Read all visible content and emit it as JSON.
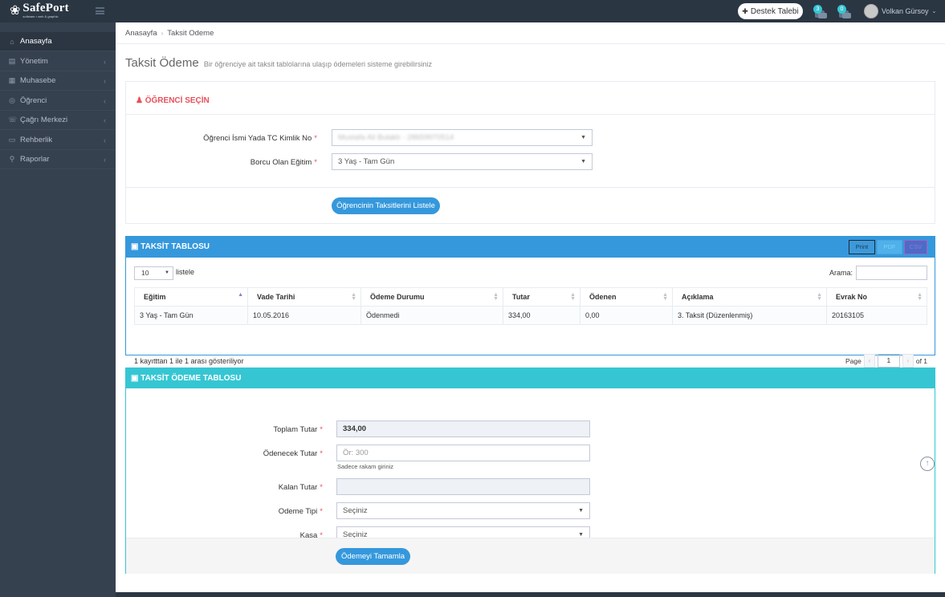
{
  "topbar": {
    "logo_name": "SafePort",
    "logo_tagline": "software • web & graphic",
    "support_label": "Destek Talebi",
    "notif_badge_1": "3",
    "notif_badge_2": "0",
    "user_name": "Volkan Gürsoy"
  },
  "sidebar": {
    "items": [
      {
        "label": "Anasayfa",
        "icon": "home-icon"
      },
      {
        "label": "Yönetim",
        "icon": "admin-icon"
      },
      {
        "label": "Muhasebe",
        "icon": "accounting-icon"
      },
      {
        "label": "Öğrenci",
        "icon": "student-icon"
      },
      {
        "label": "Çağrı Merkezi",
        "icon": "call-center-icon"
      },
      {
        "label": "Rehberlik",
        "icon": "guidance-icon"
      },
      {
        "label": "Raporlar",
        "icon": "reports-icon"
      }
    ]
  },
  "breadcrumb": {
    "home": "Anasayfa",
    "current": "Taksit Odeme"
  },
  "page": {
    "title": "Taksit Ödeme",
    "subtitle": "Bir öğrenciye ait taksit tablolarına ulaşıp ödemeleri sisteme girebilirsiniz"
  },
  "student_select": {
    "title": "ÖĞRENCİ SEÇİN",
    "student_label": "Öğrenci İsmi Yada TC Kimlik No",
    "student_value": "Mustafa Ali Bulaklı - 28659970514",
    "education_label": "Borcu Olan Eğitim",
    "education_value": "3 Yaş - Tam Gün",
    "list_button": "Öğrencinin Taksitlerini Listele"
  },
  "installment_table": {
    "title": "TAKSİT TABLOSU",
    "tools": {
      "print": "Print",
      "pdf": "PDF",
      "csv": "CSV"
    },
    "page_length": "10",
    "length_suffix": "listele",
    "search_label": "Arama:",
    "columns": [
      "Eğitim",
      "Vade Tarihi",
      "Ödeme Durumu",
      "Tutar",
      "Ödenen",
      "Açıklama",
      "Evrak No"
    ],
    "rows": [
      [
        "3 Yaş - Tam Gün",
        "10.05.2016",
        "Ödenmedi",
        "334,00",
        "0,00",
        "3. Taksit (Düzenlenmiş)",
        "20163105"
      ]
    ],
    "info": "1 kayıtttan 1 ile 1 arası gösteriliyor",
    "pager": {
      "label": "Page",
      "prev": "‹",
      "current": "1",
      "next": "›",
      "of": "of 1"
    }
  },
  "payment_form": {
    "title": "TAKSİT ÖDEME TABLOSU",
    "total_label": "Toplam Tutar",
    "total_value": "334,00",
    "pay_label": "Ödenecek Tutar",
    "pay_placeholder": "Ör: 300",
    "pay_help": "Sadece rakam giriniz",
    "remaining_label": "Kalan Tutar",
    "remaining_value": "",
    "type_label": "Odeme Tipi",
    "type_value": "Seçiniz",
    "cash_label": "Kasa",
    "cash_value": "Seçiniz",
    "submit": "Ödemeyi Tamamla"
  },
  "colors": {
    "sidebar_bg": "#364150",
    "blue": "#3598dc",
    "cyan": "#36c6d3",
    "red": "#e7505a"
  }
}
